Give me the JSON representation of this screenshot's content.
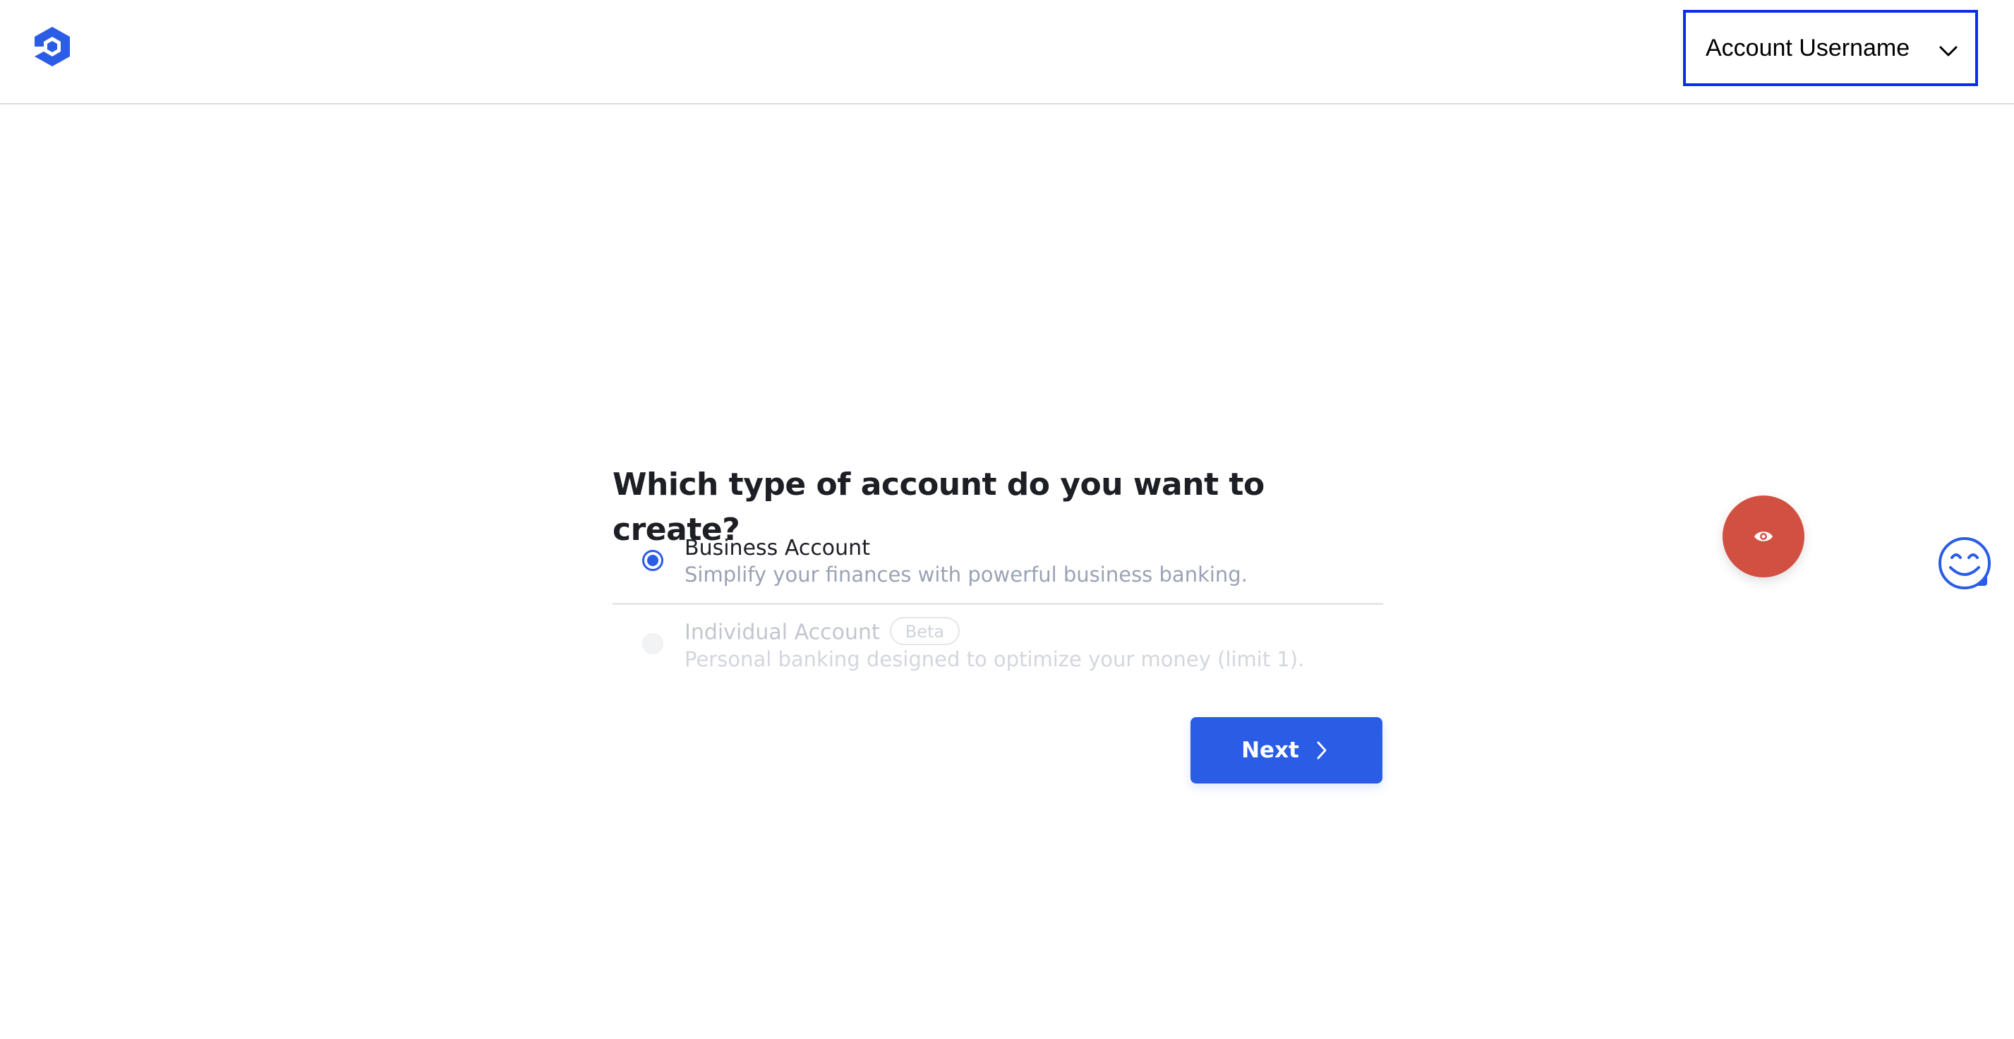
{
  "header": {
    "logo_icon": "hexagon-logo-icon",
    "account_select": {
      "label": "Account Username",
      "icon": "chevron-down-icon"
    }
  },
  "main": {
    "question": "Which type of account do you want to create?",
    "options": [
      {
        "title": "Business Account",
        "description": "Simplify your finances with powerful business banking.",
        "selected": true,
        "disabled": false
      },
      {
        "title": "Individual Account",
        "badge": "Beta",
        "description": "Personal banking designed to optimize your money (limit 1).",
        "selected": false,
        "disabled": true
      }
    ],
    "next_button": {
      "label": "Next",
      "icon": "chevron-right-icon"
    }
  },
  "floating": {
    "eye_button_icon": "eye-icon",
    "feedback_icon": "smiley-icon"
  },
  "colors": {
    "primary": "#2a5ce6",
    "focus_border": "#0b2cf0",
    "fab_red": "#d25041",
    "text_dark": "#1d1f24",
    "text_muted": "#9aa2b4"
  }
}
